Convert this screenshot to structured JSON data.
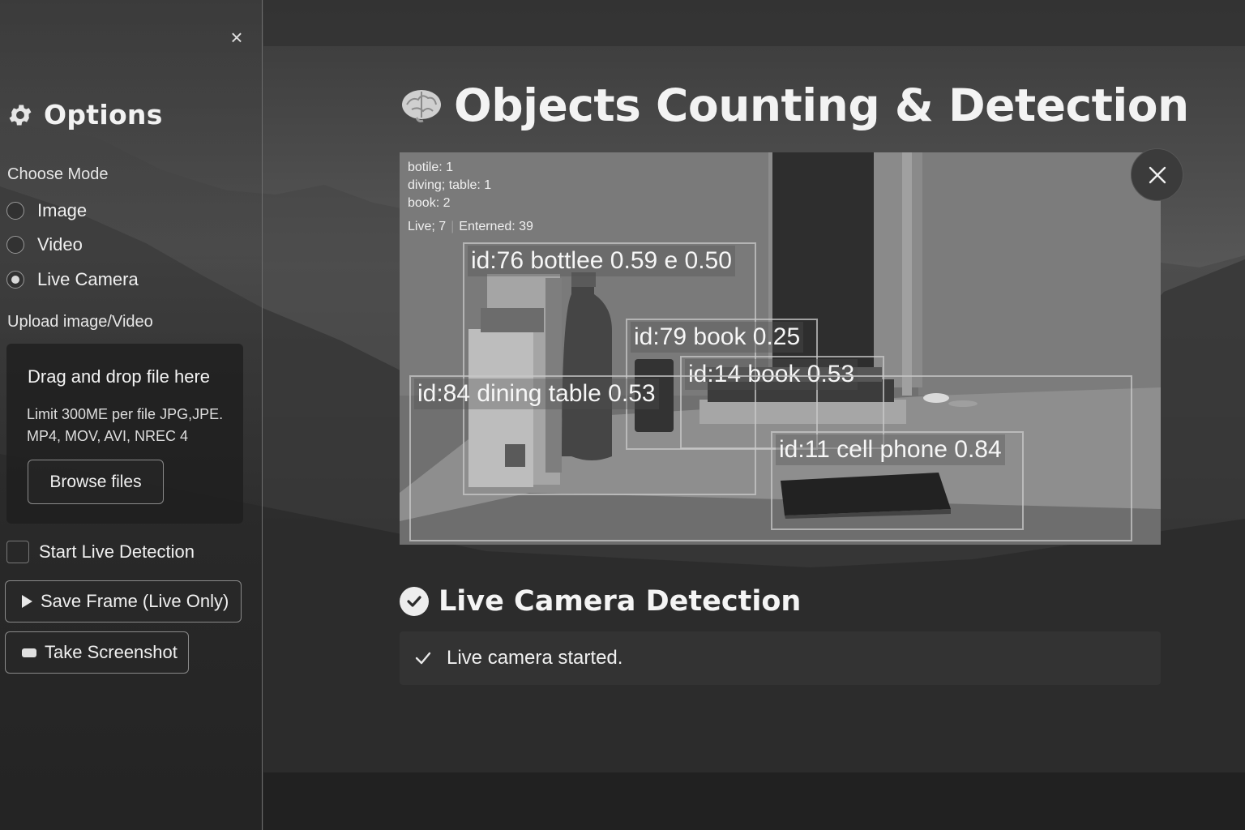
{
  "page": {
    "title": "Objects Counting & Detection",
    "title_icon": "brain-icon"
  },
  "sidebar": {
    "title": "Options",
    "title_icon": "gear-icon",
    "mode_label": "Choose Mode",
    "modes": [
      {
        "label": "Image",
        "selected": false
      },
      {
        "label": "Video",
        "selected": false
      },
      {
        "label": "Live Camera",
        "selected": true
      }
    ],
    "upload_label": "Upload image/Video",
    "upload": {
      "drag_text": "Drag and drop file here",
      "limit_line1": "Limit 300ME per file JPG,JPE.",
      "limit_line2": "MP4, MOV, AVI, NREC 4",
      "browse_label": "Browse files"
    },
    "start_live_label": "Start Live Detection",
    "start_live_checked": false,
    "save_frame_label": "Save Frame (Live Only)",
    "screenshot_label": "Take Screenshot"
  },
  "feed": {
    "counts": {
      "line1": "botile:  1",
      "line2": "diving;  table:  1",
      "line3": "book:  2",
      "live": "Live;  7",
      "entered": "Enterned: 39"
    },
    "detections": [
      {
        "label": "id:76  bottlee 0.59 e 0.50"
      },
      {
        "label": "id:79  book 0.25"
      },
      {
        "label": "id:14  book 0.53"
      },
      {
        "label": "id:84  dining table 0.53"
      },
      {
        "label": "id:11 cell phone 0.84"
      }
    ]
  },
  "section": {
    "title": "Live Camera Detection",
    "status": "Live camera started."
  }
}
